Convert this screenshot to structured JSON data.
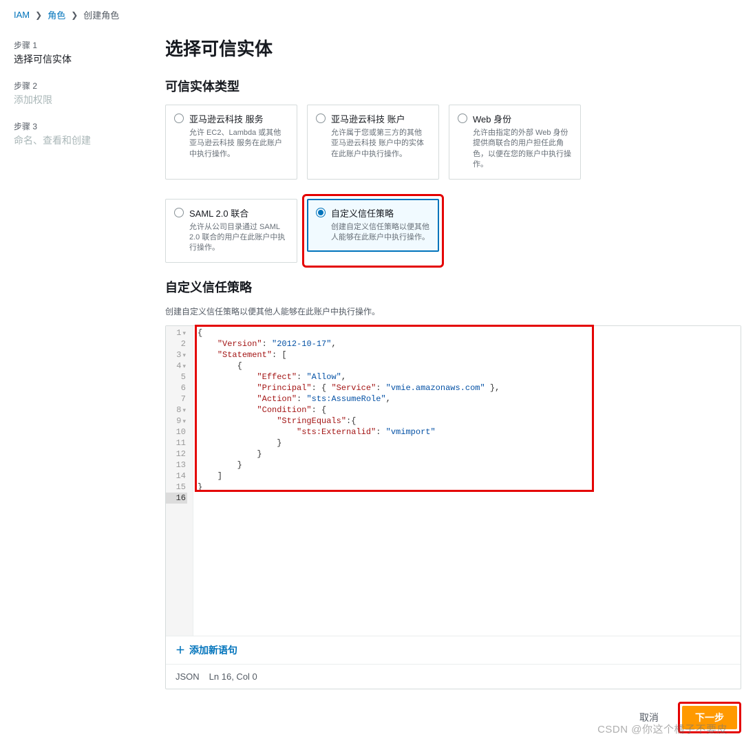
{
  "breadcrumb": {
    "iam": "IAM",
    "roles": "角色",
    "create": "创建角色"
  },
  "steps": [
    {
      "label": "步骤 1",
      "title": "选择可信实体",
      "active": true
    },
    {
      "label": "步骤 2",
      "title": "添加权限",
      "active": false
    },
    {
      "label": "步骤 3",
      "title": "命名、查看和创建",
      "active": false
    }
  ],
  "heading": "选择可信实体",
  "section_entity_type": "可信实体类型",
  "options": [
    {
      "title": "亚马逊云科技 服务",
      "desc": "允许 EC2、Lambda 或其他 亚马逊云科技 服务在此账户中执行操作。",
      "selected": false
    },
    {
      "title": "亚马逊云科技 账户",
      "desc": "允许属于您或第三方的其他 亚马逊云科技 账户中的实体在此账户中执行操作。",
      "selected": false
    },
    {
      "title": "Web 身份",
      "desc": "允许由指定的外部 Web 身份提供商联合的用户担任此角色，以便在您的账户中执行操作。",
      "selected": false
    },
    {
      "title": "SAML 2.0 联合",
      "desc": "允许从公司目录通过 SAML 2.0 联合的用户在此账户中执行操作。",
      "selected": false
    },
    {
      "title": "自定义信任策略",
      "desc": "创建自定义信任策略以便其他人能够在此账户中执行操作。",
      "selected": true
    }
  ],
  "policy_section": {
    "title": "自定义信任策略",
    "desc": "创建自定义信任策略以便其他人能够在此账户中执行操作。"
  },
  "code_lines": [
    "{",
    "    \"Version\": \"2012-10-17\",",
    "    \"Statement\": [",
    "        {",
    "            \"Effect\": \"Allow\",",
    "            \"Principal\": { \"Service\": \"vmie.amazonaws.com\" },",
    "            \"Action\": \"sts:AssumeRole\",",
    "            \"Condition\": {",
    "                \"StringEquals\":{",
    "                    \"sts:Externalid\": \"vmimport\"",
    "                }",
    "            }",
    "        }",
    "    ]",
    "}",
    ""
  ],
  "add_statement": "添加新语句",
  "status": {
    "lang": "JSON",
    "pos": "Ln 16, Col 0"
  },
  "footer": {
    "cancel": "取消",
    "next": "下一步"
  },
  "watermark": "CSDN @你这个橘子不要皮"
}
